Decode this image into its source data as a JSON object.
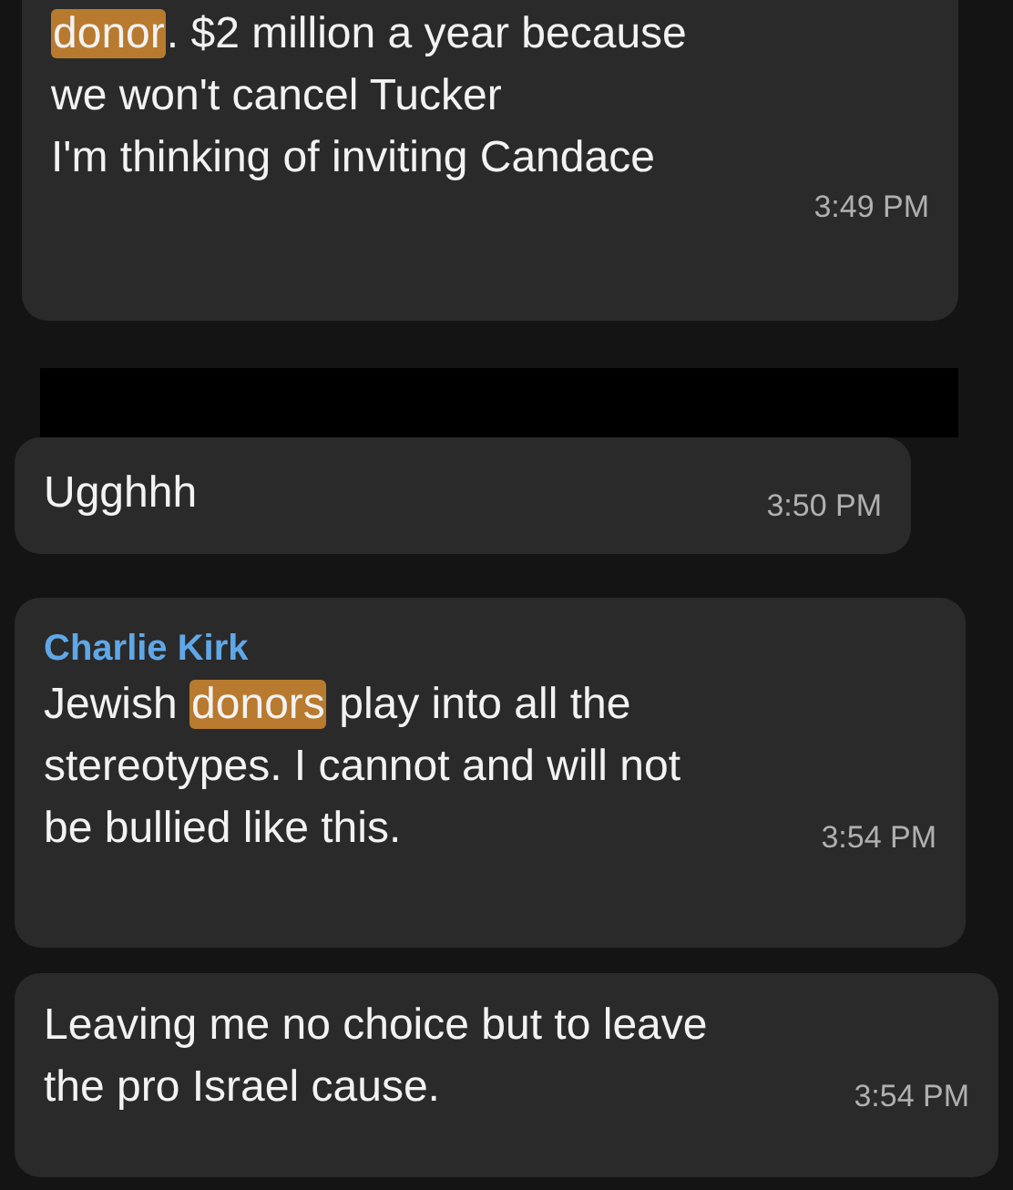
{
  "messages": [
    {
      "kind": "text",
      "segments": [
        {
          "text": "donor",
          "highlighted": true
        },
        {
          "text": ". $2 million a year because\nwe won't cancel Tucker\nI'm thinking of inviting Candace",
          "highlighted": false
        }
      ],
      "time": "3:49 PM"
    },
    {
      "kind": "redacted"
    },
    {
      "kind": "text",
      "segments": [
        {
          "text": "Ugghhh",
          "highlighted": false
        }
      ],
      "time": "3:50 PM"
    },
    {
      "kind": "text",
      "sender": "Charlie Kirk",
      "segments": [
        {
          "text": "Jewish ",
          "highlighted": false
        },
        {
          "text": "donors",
          "highlighted": true
        },
        {
          "text": " play into all the\nstereotypes. I cannot and will not\nbe bullied like this.",
          "highlighted": false
        }
      ],
      "time": "3:54 PM"
    },
    {
      "kind": "text",
      "segments": [
        {
          "text": "Leaving me no choice but to leave\nthe pro Israel cause.",
          "highlighted": false
        }
      ],
      "time": "3:54 PM"
    }
  ]
}
